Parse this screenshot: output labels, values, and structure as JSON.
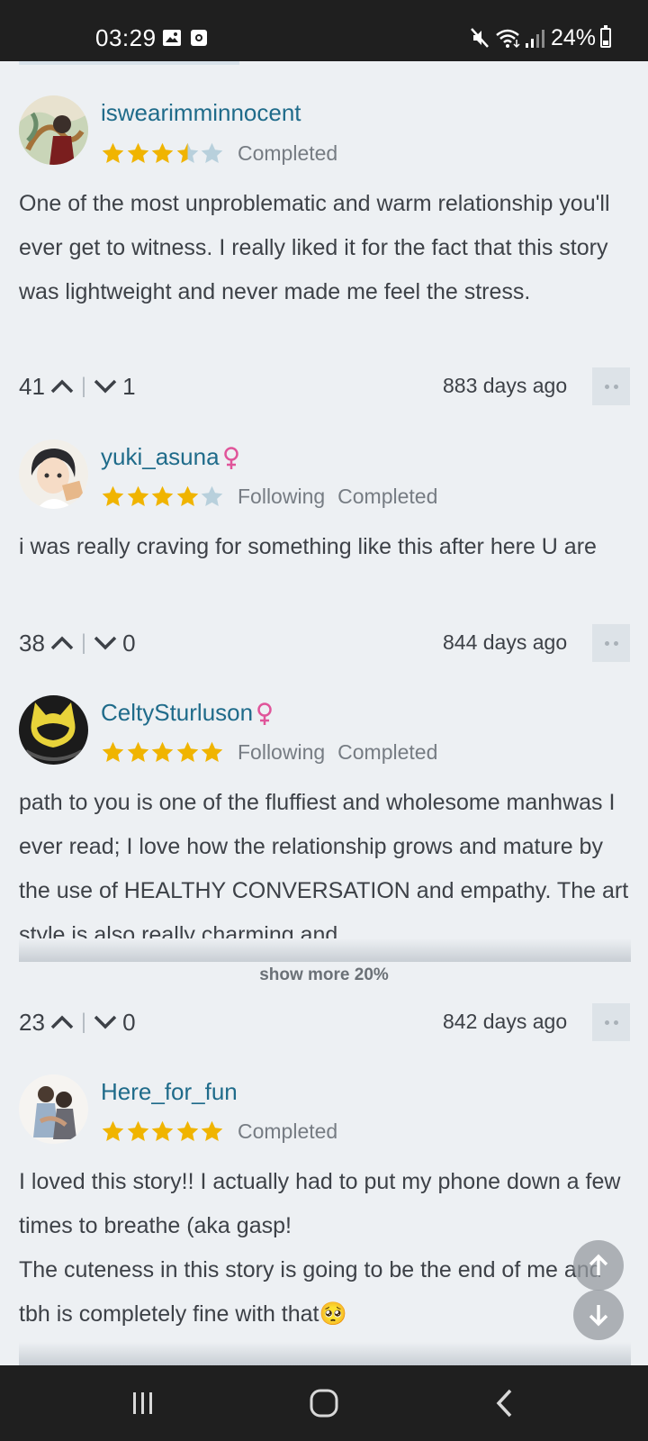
{
  "status_bar": {
    "time": "03:29",
    "battery_percent": "24%",
    "icons": [
      "image-icon",
      "notification-icon",
      "mute-icon",
      "wifi-icon",
      "signal-icon",
      "battery-icon"
    ]
  },
  "reviews": [
    {
      "username": "iswearimminnocent",
      "gender_icon": null,
      "rating": 3.5,
      "tags": [
        "Completed"
      ],
      "text": "One of the most unproblematic and warm relationship you'll ever get to witness. I really liked it for the fact that this story was lightweight and never made me feel the stress.",
      "upvotes": "41",
      "downvotes": "1",
      "time_ago": "883 days ago"
    },
    {
      "username": "yuki_asuna",
      "gender_icon": "female-icon",
      "rating": 4,
      "tags": [
        "Following",
        "Completed"
      ],
      "text": "i was really craving for something like this after here U are",
      "upvotes": "38",
      "downvotes": "0",
      "time_ago": "844 days ago"
    },
    {
      "username": "CeltySturluson",
      "gender_icon": "female-icon",
      "rating": 5,
      "tags": [
        "Following",
        "Completed"
      ],
      "text": "path to you is one of the fluffiest and wholesome manhwas I ever read; I love how the relationship grows and mature by the use of HEALTHY CONVERSATION and empathy. The art style is also really charming and",
      "show_more": "show more 20%",
      "upvotes": "23",
      "downvotes": "0",
      "time_ago": "842 days ago"
    },
    {
      "username": "Here_for_fun",
      "gender_icon": null,
      "rating": 5,
      "tags": [
        "Completed"
      ],
      "text": "I loved this story!! I actually had to put my phone down a few times to breathe (aka gasp!",
      "text_line2": "The cuteness in this story is going to be the end of me and tbh is completely fine with that",
      "emoji": "🥺"
    }
  ],
  "colors": {
    "username": "#1f6b8a",
    "star_filled": "#f0b400",
    "star_empty": "#b8d0dc",
    "female_icon": "#e0559a",
    "background": "#edf0f3"
  }
}
